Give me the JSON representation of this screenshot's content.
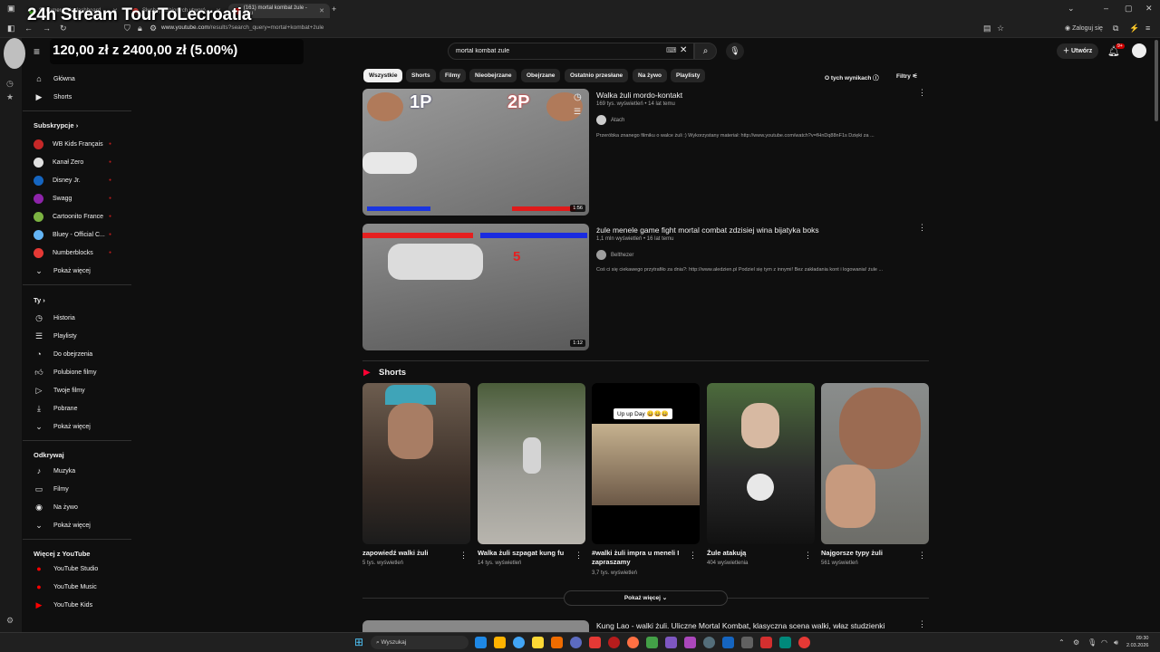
{
  "overlay": {
    "stream_title": "24h Stream TourToLecroatia",
    "donation": "120,00 zł z 2400,00 zł (5.00%)"
  },
  "browser": {
    "tabs": [
      {
        "label": "Streamer Kids dashboard",
        "active": false
      },
      {
        "label": "Słuchaj ulubionych utworó...",
        "active": false
      },
      {
        "label": "(161) mortal kombat żule - You",
        "active": true
      }
    ],
    "url_prefix": "www.youtube.com",
    "url_rest": "/results?search_query=mortal+kombat+żule",
    "profile_label": "Zaloguj się"
  },
  "search": {
    "query": "mortal kombat żule"
  },
  "header": {
    "create_label": "Utwórz",
    "notif_badge": "9+"
  },
  "sidebar": {
    "main": [
      {
        "label": "Główna",
        "icon": "home-icon"
      },
      {
        "label": "Shorts",
        "icon": "shorts-icon"
      }
    ],
    "subs_heading": "Subskrypcje",
    "subs": [
      {
        "label": "WB Kids Français",
        "color": "#c62828"
      },
      {
        "label": "Kanał Zero",
        "color": "#e0e0e0"
      },
      {
        "label": "Disney Jr.",
        "color": "#1565c0"
      },
      {
        "label": "Swagg",
        "color": "#8e24aa"
      },
      {
        "label": "Cartoonito France",
        "color": "#7cb342"
      },
      {
        "label": "Bluey - Official C...",
        "color": "#64b5f6"
      },
      {
        "label": "Numberblocks",
        "color": "#e53935"
      }
    ],
    "subs_more": "Pokaż więcej",
    "you_heading": "Ty",
    "you": [
      {
        "label": "Historia",
        "icon": "history-icon"
      },
      {
        "label": "Playlisty",
        "icon": "playlist-icon"
      },
      {
        "label": "Do obejrzenia",
        "icon": "watch-later-icon"
      },
      {
        "label": "Polubione filmy",
        "icon": "like-icon"
      },
      {
        "label": "Twoje filmy",
        "icon": "your-videos-icon"
      },
      {
        "label": "Pobrane",
        "icon": "download-icon"
      },
      {
        "label": "Pokaż więcej",
        "icon": "chevron-down-icon"
      }
    ],
    "explore_heading": "Odkrywaj",
    "explore": [
      {
        "label": "Muzyka",
        "icon": "music-icon"
      },
      {
        "label": "Filmy",
        "icon": "film-icon"
      },
      {
        "label": "Na żywo",
        "icon": "live-icon"
      },
      {
        "label": "Pokaż więcej",
        "icon": "chevron-down-icon"
      }
    ],
    "more_heading": "Więcej z YouTube",
    "more": [
      {
        "label": "YouTube Studio"
      },
      {
        "label": "YouTube Music"
      },
      {
        "label": "YouTube Kids"
      }
    ]
  },
  "chips": [
    "Wszystkie",
    "Shorts",
    "Filmy",
    "Nieobejrzane",
    "Obejrzane",
    "Ostatnio przesłane",
    "Na żywo",
    "Playlisty"
  ],
  "about_results": "O tych wynikach",
  "filters": "Filtry",
  "videos": [
    {
      "title": "Walka żuli mordo-kontakt",
      "meta": "169 tys. wyświetleń • 14 lat temu",
      "channel": "Atach",
      "desc": "Przeróbka znanego filmiku o walce żuli :) Wykorzystany materiał: http://www.youtube.com/watch?v=fHnDq88nF1s Dzięki za ...",
      "duration": "1:56",
      "p1": "1P",
      "p2": "2P"
    },
    {
      "title": "żule menele game fight mortal combat zdzisiej wina bijatyka boks",
      "meta": "1,1 mln wyświetleń • 16 lat temu",
      "channel": "Belthezer",
      "desc": "Coś ci się ciekawego przytrafiło za dnia?: http://www.aledzien.pl Podziel się tym z innymi! Bez zakładania kont i logowania! żule ...",
      "duration": "1:12",
      "round": "5"
    }
  ],
  "shorts_heading": "Shorts",
  "shorts": [
    {
      "title": "zapowiedź walki żuli",
      "meta": "5 tys. wyświetleń"
    },
    {
      "title": "Walka żuli szpagat kung fu",
      "meta": "14 tys. wyświetleń"
    },
    {
      "title": "#walki żuli impra u meneli I zapraszamy",
      "meta": "3,7 tys. wyświetleń",
      "caption": "Up up Day 😄😄😄"
    },
    {
      "title": "Żule atakują",
      "meta": "404 wyświetlenia"
    },
    {
      "title": "Najgorsze typy żuli",
      "meta": "561 wyświetleń"
    }
  ],
  "show_more": "Pokaż więcej",
  "next_video_title": "Kung Lao - walki żuli. Uliczne Mortal Kombat, klasyczna scena walki, właz studzienki",
  "taskbar": {
    "search_placeholder": "Wyszukaj",
    "time": "09:30",
    "date": "2.03.2026"
  }
}
